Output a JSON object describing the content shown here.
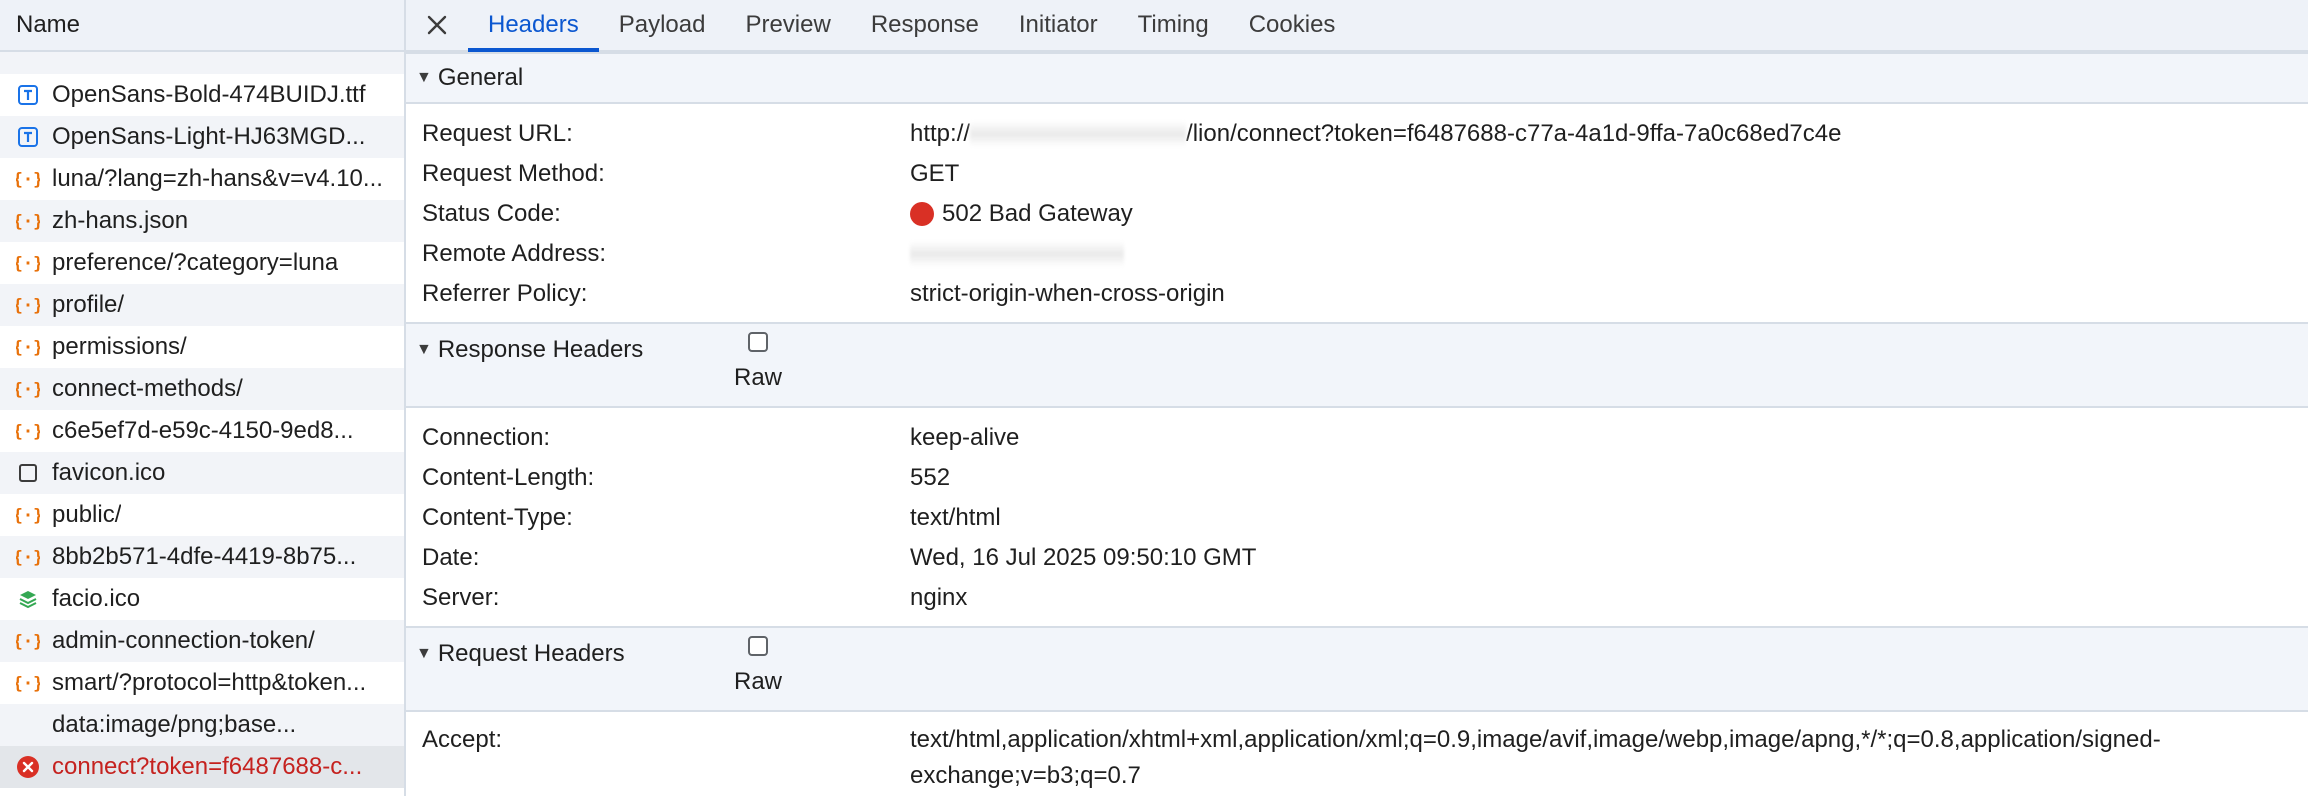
{
  "list": {
    "header": "Name",
    "rows": [
      {
        "icon": "document-icon",
        "label": "OpenSans-Bold-474BUIDJ.ttf"
      },
      {
        "icon": "document-icon",
        "label": "OpenSans-Light-HJ63MGD..."
      },
      {
        "icon": "fetch-icon",
        "label": "luna/?lang=zh-hans&v=v4.10..."
      },
      {
        "icon": "fetch-icon",
        "label": "zh-hans.json"
      },
      {
        "icon": "fetch-icon",
        "label": "preference/?category=luna"
      },
      {
        "icon": "fetch-icon",
        "label": "profile/"
      },
      {
        "icon": "fetch-icon",
        "label": "permissions/"
      },
      {
        "icon": "fetch-icon",
        "label": "connect-methods/"
      },
      {
        "icon": "fetch-icon",
        "label": "c6e5ef7d-e59c-4150-9ed8..."
      },
      {
        "icon": "file-icon",
        "label": "favicon.ico"
      },
      {
        "icon": "fetch-icon",
        "label": "public/"
      },
      {
        "icon": "fetch-icon",
        "label": "8bb2b571-4dfe-4419-8b75..."
      },
      {
        "icon": "image-stack-icon",
        "label": "facio.ico"
      },
      {
        "icon": "fetch-icon",
        "label": "admin-connection-token/"
      },
      {
        "icon": "fetch-icon",
        "label": "smart/?protocol=http&token..."
      },
      {
        "icon": "none",
        "label": "data:image/png;base..."
      },
      {
        "icon": "error-icon",
        "label": "connect?token=f6487688-c..."
      }
    ]
  },
  "tabs": {
    "close_icon": "close-icon",
    "items": [
      "Headers",
      "Payload",
      "Preview",
      "Response",
      "Initiator",
      "Timing",
      "Cookies"
    ],
    "active": "Headers"
  },
  "general": {
    "title": "General",
    "rows": [
      {
        "key": "Request URL:",
        "value_prefix": "http://",
        "value_suffix": "/lion/connect?token=f6487688-c77a-4a1d-9ffa-7a0c68ed7c4e"
      },
      {
        "key": "Request Method:",
        "value": "GET"
      },
      {
        "key": "Status Code:",
        "value": "502 Bad Gateway",
        "status_color": "#d93025"
      },
      {
        "key": "Remote Address:",
        "value": ""
      },
      {
        "key": "Referrer Policy:",
        "value": "strict-origin-when-cross-origin"
      }
    ]
  },
  "response_headers": {
    "title": "Response Headers",
    "raw_label": "Raw",
    "rows": [
      {
        "key": "Connection:",
        "value": "keep-alive"
      },
      {
        "key": "Content-Length:",
        "value": "552"
      },
      {
        "key": "Content-Type:",
        "value": "text/html"
      },
      {
        "key": "Date:",
        "value": "Wed, 16 Jul 2025 09:50:10 GMT"
      },
      {
        "key": "Server:",
        "value": "nginx"
      }
    ]
  },
  "request_headers": {
    "title": "Request Headers",
    "raw_label": "Raw",
    "rows": [
      {
        "key": "Accept:",
        "value": "text/html,application/xhtml+xml,application/xml;q=0.9,image/avif,image/webp,image/apng,*/*;q=0.8,application/signed-exchange;v=b3;q=0.7"
      }
    ]
  },
  "colors": {
    "accent": "#0b57d0",
    "error": "#c5221f",
    "fetch_icon": "#e8710a",
    "document_icon": "#1a73e8",
    "image_icon": "#34a853"
  }
}
